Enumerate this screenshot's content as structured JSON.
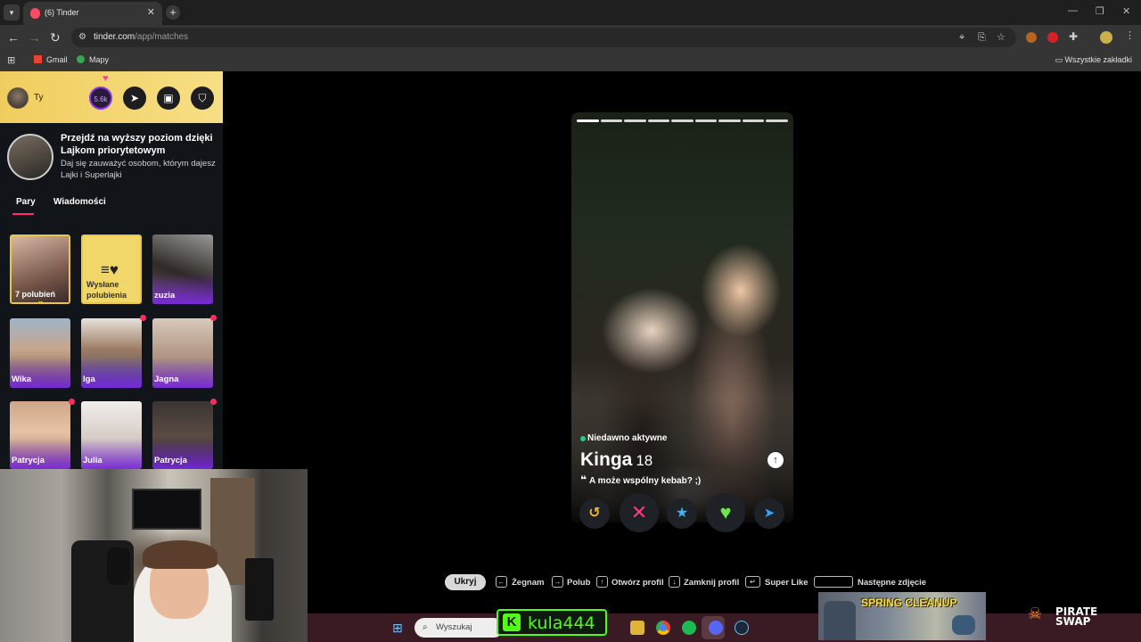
{
  "browser": {
    "tab_title": "(6) Tinder",
    "url_host": "tinder.com",
    "url_path": "/app/matches",
    "bookmarks": [
      "Gmail",
      "Mapy"
    ],
    "bookmarks_right": "Wszystkie zakładki"
  },
  "sidebar": {
    "user_name": "Ty",
    "likes_badge": "5.6k",
    "promo": {
      "title": "Przejdź na wyższy poziom dzięki Lajkom priorytetowym",
      "subtitle": "Daj się zauważyć osobom, którym dajesz Lajki i Superlajki"
    },
    "tabs": [
      "Pary",
      "Wiadomości"
    ],
    "likes_card_label": "7 polubień",
    "sent_card_label": "Wysłane polubienia",
    "matches": [
      {
        "name": "zuzia",
        "new": false
      },
      {
        "name": "Wika",
        "new": false
      },
      {
        "name": "Iga",
        "new": true
      },
      {
        "name": "Jagna",
        "new": true
      },
      {
        "name": "Patrycja",
        "new": true
      },
      {
        "name": "Julia",
        "new": false
      },
      {
        "name": "Patrycja",
        "new": true
      }
    ]
  },
  "profile": {
    "photo_count": 9,
    "active_photo": 1,
    "status": "Niedawno aktywne",
    "name": "Kinga",
    "age": "18",
    "bio": "A może wspólny kebab? ;)"
  },
  "actions": {
    "rewind": {
      "icon": "rewind-icon",
      "color": "#f6b52d"
    },
    "nope": {
      "icon": "close-icon",
      "color": "#fd3a73"
    },
    "superlike": {
      "icon": "star-icon",
      "color": "#3ab4f2"
    },
    "like": {
      "icon": "heart-icon",
      "color": "#6ee64a"
    },
    "boost": {
      "icon": "send-icon",
      "color": "#3aa0f2"
    }
  },
  "hints": {
    "hide": "Ukryj",
    "nope": "Żegnam",
    "like": "Polub",
    "open": "Otwórz profil",
    "close": "Zamknij profil",
    "superlike": "Super Like",
    "next": "Następne zdjęcie"
  },
  "taskbar": {
    "search_placeholder": "Wyszukaj"
  },
  "overlays": {
    "kick_username": "kula444",
    "spring_title": "SPRING CLEANUP",
    "pirate_line1": "PIRATE",
    "pirate_line2": "SWAP"
  }
}
